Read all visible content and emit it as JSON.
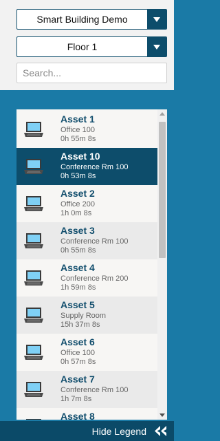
{
  "building_select": {
    "value": "Smart Building Demo"
  },
  "floor_select": {
    "value": "Floor 1"
  },
  "search": {
    "placeholder": "Search...",
    "value": ""
  },
  "assets": [
    {
      "name": "Asset 1",
      "location": "Office 100",
      "duration": "0h 55m 8s",
      "icon": "laptop-icon",
      "selected": false
    },
    {
      "name": "Asset 10",
      "location": "Conference Rm 100",
      "duration": "0h 53m 8s",
      "icon": "laptop-icon",
      "selected": true
    },
    {
      "name": "Asset 2",
      "location": "Office 200",
      "duration": "1h 0m 8s",
      "icon": "laptop-icon",
      "selected": false
    },
    {
      "name": "Asset 3",
      "location": "Conference Rm 100",
      "duration": "0h 55m 8s",
      "icon": "laptop-icon",
      "selected": false
    },
    {
      "name": "Asset 4",
      "location": "Conference Rm 200",
      "duration": "1h 59m 8s",
      "icon": "laptop-icon",
      "selected": false
    },
    {
      "name": "Asset 5",
      "location": "Supply Room",
      "duration": "15h 37m 8s",
      "icon": "laptop-icon",
      "selected": false
    },
    {
      "name": "Asset 6",
      "location": "Office 100",
      "duration": "0h 57m 8s",
      "icon": "laptop-icon",
      "selected": false
    },
    {
      "name": "Asset 7",
      "location": "Conference Rm 100",
      "duration": "1h 7m 8s",
      "icon": "laptop-icon",
      "selected": false
    },
    {
      "name": "Asset 8",
      "location": "",
      "duration": "",
      "icon": "laptop-icon",
      "selected": false
    }
  ],
  "footer": {
    "hide_label": "Hide Legend",
    "icon": "double-chevron-left-icon"
  },
  "colors": {
    "panel_blue": "#1a7aa6",
    "dark_teal": "#0d4d6b",
    "footer": "#0b4a68"
  }
}
